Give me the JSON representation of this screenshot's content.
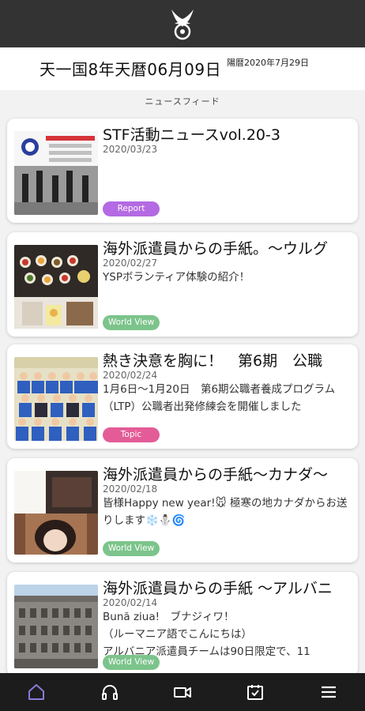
{
  "header": {
    "date_main": "天一国8年天暦06月09日",
    "date_sub": "陽暦2020年7月29日"
  },
  "feed": {
    "section_title": "ニュースフィード",
    "items": [
      {
        "title": "STF活動ニュースvol.20-3",
        "date": "2020/03/23",
        "body": "",
        "tag": "Report",
        "tag_color": "#b36ae2"
      },
      {
        "title": "海外派遣員からの手紙。～ウルグ",
        "date": "2020/02/27",
        "body": "YSPボランティア体験の紹介！",
        "tag": "World View",
        "tag_color": "#7cc48b"
      },
      {
        "title": "熱き決意を胸に！　第6期　公職",
        "date": "2020/02/24",
        "body": "1月6日～1月20日　第6期公職者養成プログラム（LTP）公職者出発修練会を開催しました",
        "tag": "Topic",
        "tag_color": "#e45c97"
      },
      {
        "title": "海外派遣員からの手紙～カナダ～",
        "date": "2020/02/18",
        "body": "皆様Happy new year!🐭 極寒の地カナダからお送りします❄️⛄🌀",
        "tag": "World View",
        "tag_color": "#7cc48b"
      },
      {
        "title": "海外派遣員からの手紙 ～アルバニ",
        "date": "2020/02/14",
        "body": "Bună ziua!　ブナジィワ！\n（ルーマニア語でこんにちは）\nアルバニア派遣員チームは90日限定で、11",
        "tag": "World View",
        "tag_color": "#7cc48b"
      }
    ]
  },
  "nav": {
    "items": [
      {
        "icon": "home-icon",
        "active": true
      },
      {
        "icon": "headphones-icon",
        "active": false
      },
      {
        "icon": "video-icon",
        "active": false
      },
      {
        "icon": "calendar-check-icon",
        "active": false
      },
      {
        "icon": "menu-icon",
        "active": false
      }
    ],
    "active_color": "#8a7bd8",
    "inactive_color": "#ffffff"
  }
}
